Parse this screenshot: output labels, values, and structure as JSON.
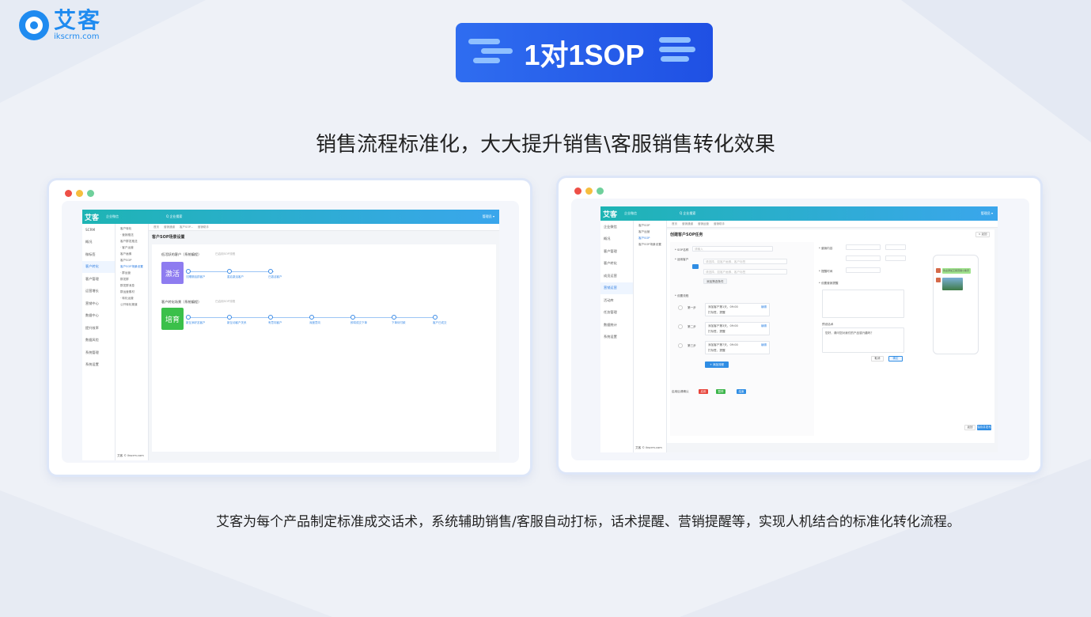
{
  "brand": {
    "name_cn": "艾客",
    "domain": "ikscrm.com",
    "accent": "#1f8bf0"
  },
  "banner": {
    "title": "1对1SOP",
    "bg": "#2f6df0"
  },
  "subtitle": "销售流程标准化，大大提升销售\\客服销售转化效果",
  "description": "艾客为每个产品制定标准成交话术，系统辅助销售/客服自动打标，话术提醒、营销提醒等，实现人机结合的标准化转化流程。",
  "window_dots": [
    "#ee4f46",
    "#f6be3e",
    "#6fd09b"
  ],
  "left_shot": {
    "topbar": {
      "logo": "艾客",
      "app": "企业微信",
      "search": "Q 企业搜索",
      "user": "管理员 ▾"
    },
    "sidebar": [
      "SCRM",
      "概况",
      "微标签",
      "客户转化",
      "客户管理",
      "运营增长",
      "营销中心",
      "数据中心",
      "提升效率",
      "数据风险",
      "系统管理",
      "系统设置"
    ],
    "sidebar_active": 3,
    "sub_sidebar": [
      "客户转化",
      "· 营销推送",
      "客户群发推送",
      "· 客户运营",
      "客户画像",
      "客户SOP",
      "客户SOP场景设置",
      "· 群运营",
      "群发群",
      "群发群消息",
      "群运营素材",
      "· 转化运营",
      "公开转化渠道"
    ],
    "sub_active": 6,
    "tabs": [
      "首页",
      "营销通道",
      "客户SOP...",
      "营销助手"
    ],
    "page_title": "客户SOP场景设置",
    "flows": [
      {
        "title": "低活跃的客户（系统编程）",
        "hint": "已启用SOP流程",
        "badge": "激活",
        "badge_color": "#8e7cf0",
        "nodes": [
          "沉睡期活跃客户",
          "重启激活客户",
          "已激活客户"
        ]
      },
      {
        "title": "客户转化场景（系统编程）",
        "hint": "已启用SOP流程",
        "badge": "培育",
        "badge_color": "#3bc04a",
        "nodes": [
          "新互添好友客户",
          "新互动客户关系",
          "有意向客户",
          "深度意向",
          "即将成交下单",
          "下单待付款",
          "客户已成交"
        ]
      }
    ],
    "footer": "艾客 © ikscrm.com"
  },
  "right_shot": {
    "topbar": {
      "logo": "艾客",
      "app": "企业微信",
      "search": "Q 企业搜索",
      "user": "管理员 ▾"
    },
    "sidebar": [
      "企业微信",
      "概况",
      "客户管理",
      "客户转化",
      "成员运营",
      "营销运营",
      "活动库",
      "任务管理",
      "数据统计",
      "系统设置"
    ],
    "sidebar_active": 5,
    "sub_sidebar": [
      "客户SOP",
      "客户运营",
      "客户SOP",
      "客户SOP场景设置"
    ],
    "sub_active": 2,
    "tabs": [
      "首页",
      "营销通道",
      "营销运营",
      "营销助手"
    ],
    "page_title": "创建客户SOP任务",
    "back_label": "< 返回",
    "fields": {
      "task_name": "* SOP名称",
      "task_name_ph": "请输入",
      "target": "* 适用客户",
      "target_ph1": "请选择，如客户画像、客户标签",
      "target_ph2": "请选择，如客户画像、客户标签",
      "add_condition": "添加筛选条件",
      "steps_label": "* 设置流程",
      "steps": [
        {
          "name": "第一步",
          "line1": "添加客户第1天，09:00",
          "line2": "打标签，提醒",
          "edit": "编辑"
        },
        {
          "name": "第二步",
          "line1": "添加客户第3天，09:00",
          "line2": "打标签，提醒",
          "edit": "编辑"
        },
        {
          "name": "第三步",
          "line1": "添加客户第7天，09:00",
          "line2": "打标签，提醒",
          "edit": "编辑"
        }
      ],
      "add_step": "+ 添加流程",
      "status_label": "启用后请确认",
      "tags": [
        "启用",
        "暂停",
        "结束"
      ],
      "right_label1": "* 营销内容",
      "right_label2": "* 提醒时间",
      "right_label3": "* 设置营销提醒",
      "msg_text": "欢迎添加艾客营销小助手",
      "reply_label": "预设话术",
      "reply_text": "您好，请问您对我们的产品感兴趣吗？",
      "btn_cancel": "取消",
      "btn_confirm": "确定",
      "footer_cancel": "返回",
      "footer_save": "保存并发布"
    },
    "footer": "艾客 © ikscrm.com"
  }
}
